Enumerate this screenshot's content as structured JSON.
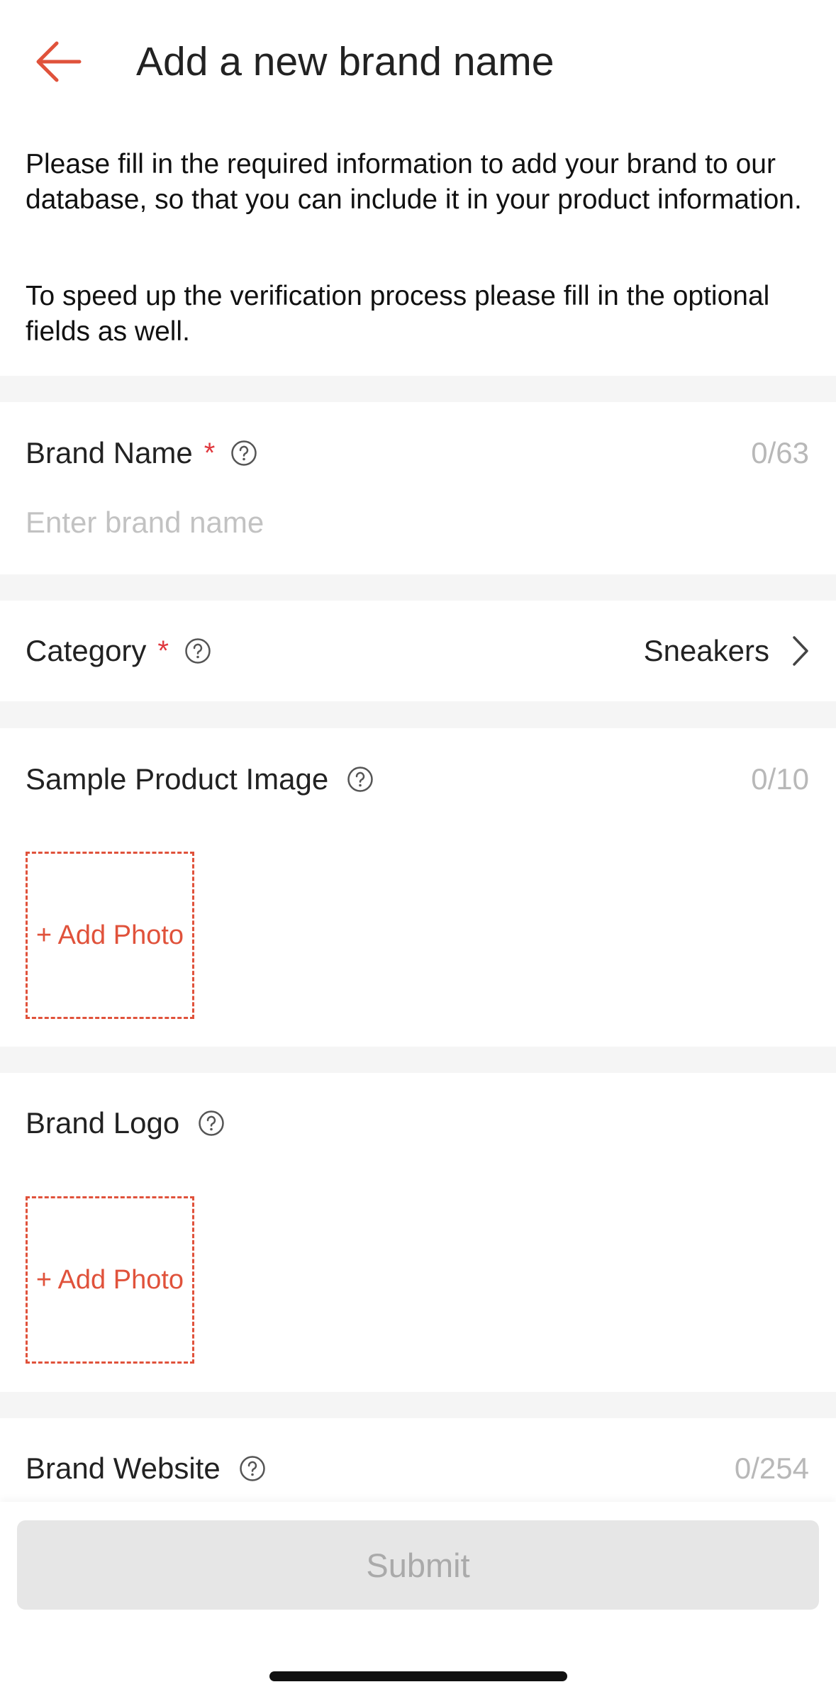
{
  "header": {
    "title": "Add a new brand name",
    "back_icon": "arrow-left-icon"
  },
  "intro": {
    "paragraph1": "Please fill in the required information to add your brand to our database, so that you can include it in your product information.",
    "paragraph2": "To speed up the verification process please fill in the optional fields as well."
  },
  "brand_name": {
    "label": "Brand Name",
    "required_mark": "*",
    "counter": "0/63",
    "placeholder": "Enter brand name",
    "value": ""
  },
  "category": {
    "label": "Category",
    "required_mark": "*",
    "value": "Sneakers"
  },
  "sample_image": {
    "label": "Sample Product Image",
    "counter": "0/10",
    "add_label": "+ Add Photo"
  },
  "brand_logo": {
    "label": "Brand Logo",
    "add_label": "+ Add Photo"
  },
  "brand_website": {
    "label": "Brand Website",
    "counter": "0/254"
  },
  "submit": {
    "label": "Submit",
    "enabled": false
  },
  "colors": {
    "accent": "#e0523b",
    "required": "#e0383e",
    "disabled_bg": "#e6e6e6"
  }
}
